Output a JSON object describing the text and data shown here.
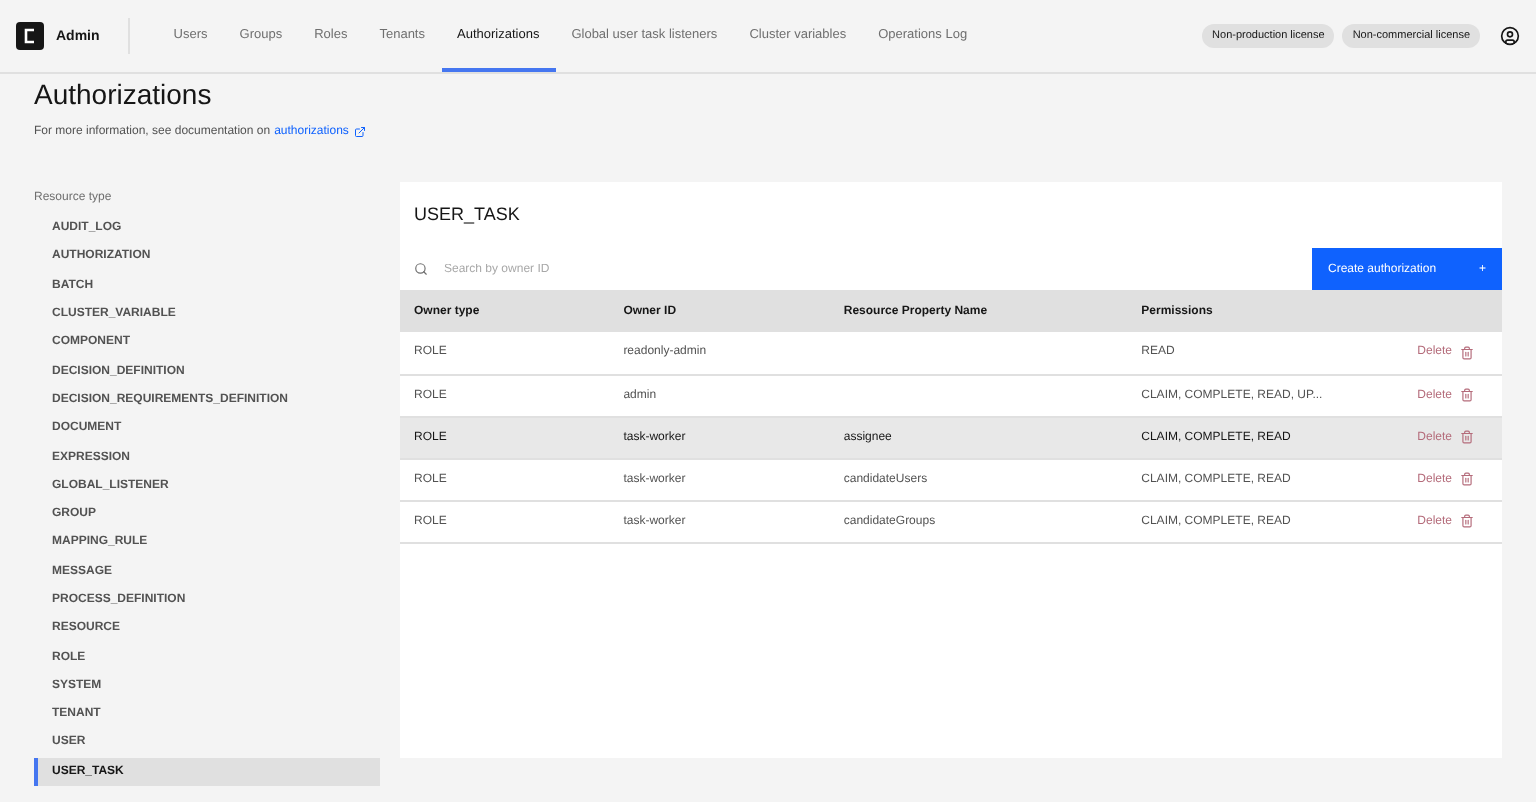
{
  "header": {
    "app_name": "Admin",
    "nav": [
      {
        "label": "Users",
        "selected": false
      },
      {
        "label": "Groups",
        "selected": false
      },
      {
        "label": "Roles",
        "selected": false
      },
      {
        "label": "Tenants",
        "selected": false
      },
      {
        "label": "Authorizations",
        "selected": true
      },
      {
        "label": "Global user task listeners",
        "selected": false
      },
      {
        "label": "Cluster variables",
        "selected": false
      },
      {
        "label": "Operations Log",
        "selected": false
      }
    ],
    "badges": [
      "Non-production license",
      "Non-commercial license"
    ]
  },
  "page": {
    "title": "Authorizations",
    "info": "For more information, see documentation on",
    "info_link": "authorizations"
  },
  "sidebar": {
    "heading": "Resource type",
    "items": [
      {
        "label": "AUDIT_LOG",
        "selected": false
      },
      {
        "label": "AUTHORIZATION",
        "selected": false
      },
      {
        "label": "BATCH",
        "selected": false
      },
      {
        "label": "CLUSTER_VARIABLE",
        "selected": false
      },
      {
        "label": "COMPONENT",
        "selected": false
      },
      {
        "label": "DECISION_DEFINITION",
        "selected": false
      },
      {
        "label": "DECISION_REQUIREMENTS_DEFINITION",
        "selected": false
      },
      {
        "label": "DOCUMENT",
        "selected": false
      },
      {
        "label": "EXPRESSION",
        "selected": false
      },
      {
        "label": "GLOBAL_LISTENER",
        "selected": false
      },
      {
        "label": "GROUP",
        "selected": false
      },
      {
        "label": "MAPPING_RULE",
        "selected": false
      },
      {
        "label": "MESSAGE",
        "selected": false
      },
      {
        "label": "PROCESS_DEFINITION",
        "selected": false
      },
      {
        "label": "RESOURCE",
        "selected": false
      },
      {
        "label": "ROLE",
        "selected": false
      },
      {
        "label": "SYSTEM",
        "selected": false
      },
      {
        "label": "TENANT",
        "selected": false
      },
      {
        "label": "USER",
        "selected": false
      },
      {
        "label": "USER_TASK",
        "selected": true
      }
    ]
  },
  "panel": {
    "title": "USER_TASK",
    "search": {
      "placeholder": "Search by owner ID"
    },
    "create_button": "Create authorization",
    "create_icon": "+",
    "table": {
      "columns": [
        "Owner type",
        "Owner ID",
        "Resource Property Name",
        "Permissions"
      ],
      "rows": [
        {
          "owner_type": "ROLE",
          "owner_id": "readonly-admin",
          "property": "",
          "permissions": "READ",
          "action": "Delete",
          "highlighted": false
        },
        {
          "owner_type": "ROLE",
          "owner_id": "admin",
          "property": "",
          "permissions": "CLAIM, COMPLETE, READ, UP...",
          "action": "Delete",
          "highlighted": false
        },
        {
          "owner_type": "ROLE",
          "owner_id": "task-worker",
          "property": "assignee",
          "permissions": "CLAIM, COMPLETE, READ",
          "action": "Delete",
          "highlighted": true
        },
        {
          "owner_type": "ROLE",
          "owner_id": "task-worker",
          "property": "candidateUsers",
          "permissions": "CLAIM, COMPLETE, READ",
          "action": "Delete",
          "highlighted": false
        },
        {
          "owner_type": "ROLE",
          "owner_id": "task-worker",
          "property": "candidateGroups",
          "permissions": "CLAIM, COMPLETE, READ",
          "action": "Delete",
          "highlighted": false
        }
      ]
    }
  }
}
